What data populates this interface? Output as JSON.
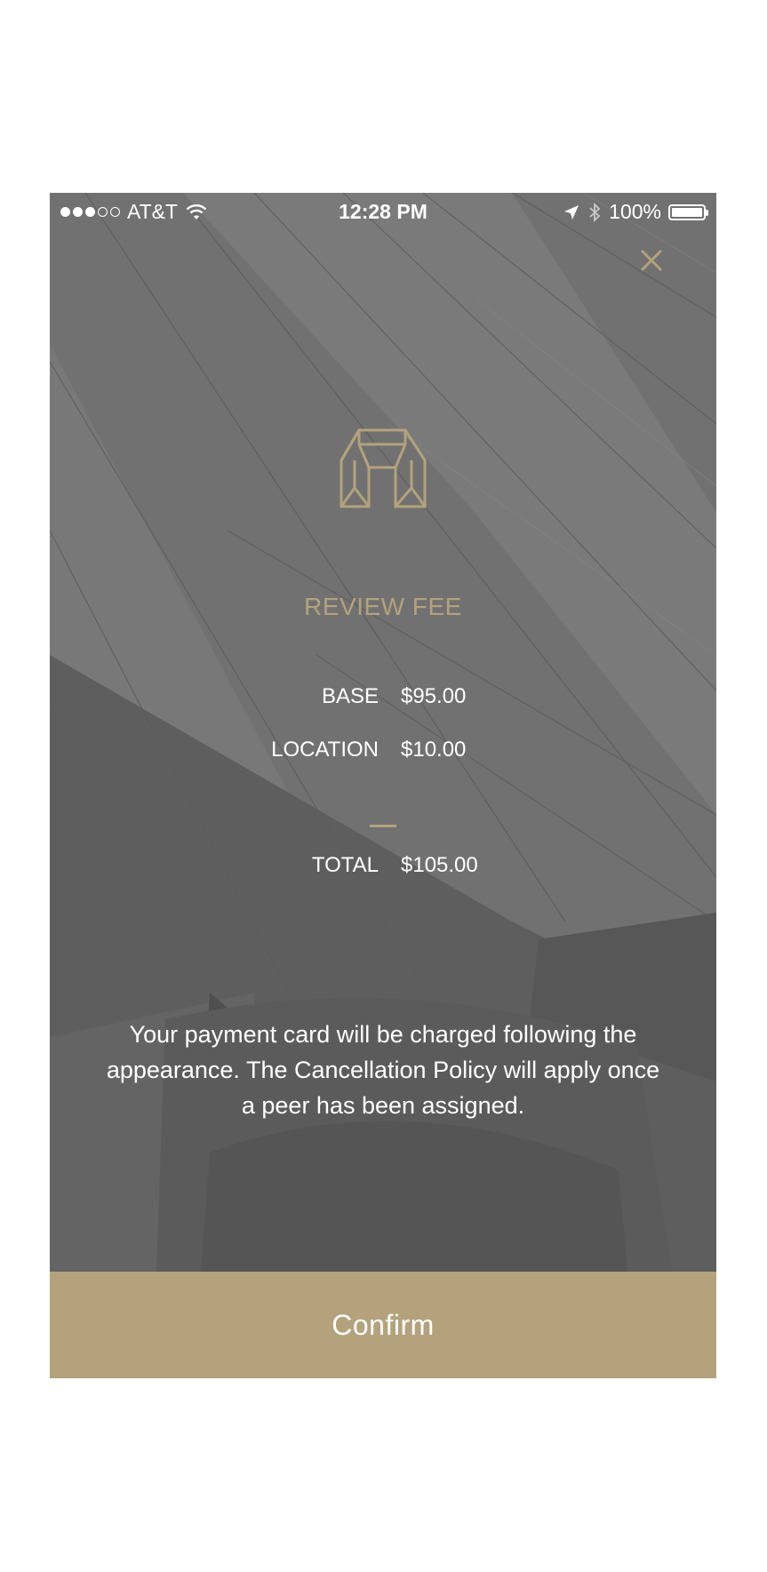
{
  "status_bar": {
    "carrier": "AT&T",
    "time": "12:28 PM",
    "battery": "100%",
    "signal_bars_filled": 3,
    "signal_bars_total": 5,
    "icons": [
      "wifi-icon",
      "location-arrow-icon",
      "bluetooth-icon",
      "battery-icon"
    ]
  },
  "header": {
    "close_icon": "close-icon",
    "logo_icon": "arch-logo-icon"
  },
  "fee": {
    "title": "REVIEW FEE",
    "items": [
      {
        "label": "BASE",
        "value": "$95.00"
      },
      {
        "label": "LOCATION",
        "value": "$10.00"
      }
    ],
    "total": {
      "label": "TOTAL",
      "value": "$105.00"
    }
  },
  "notice": "Your payment card will be charged following the appearance. The Cancellation Policy will apply once a peer has been assigned.",
  "confirm": {
    "label": "Confirm"
  },
  "colors": {
    "accent": "#b3a27c",
    "background_overlay": "#6f6f6f",
    "text": "#ffffff"
  }
}
